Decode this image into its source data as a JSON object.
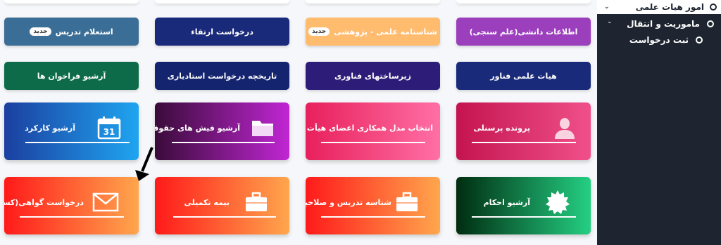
{
  "new_badge": "جدید",
  "row1": [
    {
      "label": "استعلام تدریس",
      "badge": true,
      "color": "#3b6e96"
    },
    {
      "label": "درخواست ارتقاء",
      "badge": false,
      "color": "#1a2a7a"
    },
    {
      "label": "شناسنامه علمی - پژوهشی",
      "badge": true,
      "color": "#ffbb6e"
    },
    {
      "label": "اطلاعات دانشی(علم سنجی)",
      "badge": false,
      "color": "#9b3fbd"
    }
  ],
  "row2": [
    {
      "label": "آرشیو فراخوان ها",
      "color": "#0e6b4a"
    },
    {
      "label": "تاریخچه درخواست استادیاری",
      "color": "#15246e"
    },
    {
      "label": "زیرساختهای فناوری",
      "color": "#2e1d78"
    },
    {
      "label": "هیات علمی فناور",
      "color": "#1a2a7a"
    }
  ],
  "cards_row1": [
    {
      "label": "آرشیو کارکرد",
      "icon": "calendar-icon",
      "icon_text": "31",
      "from": "#1b3fa0",
      "to": "#1fa5f0"
    },
    {
      "label": "آرشیو فیش های حقوقی",
      "icon": "folder-icon",
      "from": "#3a0b3a",
      "to": "#c026d3"
    },
    {
      "label": "انتخاب مدل همکاری اعضای هیأت علمی",
      "icon": "",
      "from": "#e8205c",
      "to": "#ff6fa5"
    },
    {
      "label": "پرونده پرسنلی",
      "icon": "user-icon",
      "from": "#c4144f",
      "to": "#f0508a"
    }
  ],
  "cards_row2": [
    {
      "label": "درخواست گواهی(کسر از حقوق و",
      "icon": "envelope-icon",
      "from": "#ff1a1a",
      "to": "#ffa64d"
    },
    {
      "label": "بیمه تکمیلی",
      "icon": "briefcase-icon",
      "from": "#ff1a1a",
      "to": "#ffa64d"
    },
    {
      "label": "شناسه تدریس و صلاحیت",
      "icon": "briefcase-icon",
      "from": "#ff1a1a",
      "to": "#ffa64d"
    },
    {
      "label": "آرشیو احکام",
      "icon": "badge-icon",
      "from": "#002d10",
      "to": "#24cf83"
    }
  ],
  "sidebar": {
    "items": [
      {
        "label": "امور هیات علمی"
      },
      {
        "label": "ماموریت و انتقال"
      },
      {
        "label": "ثبت درخواست"
      }
    ]
  }
}
